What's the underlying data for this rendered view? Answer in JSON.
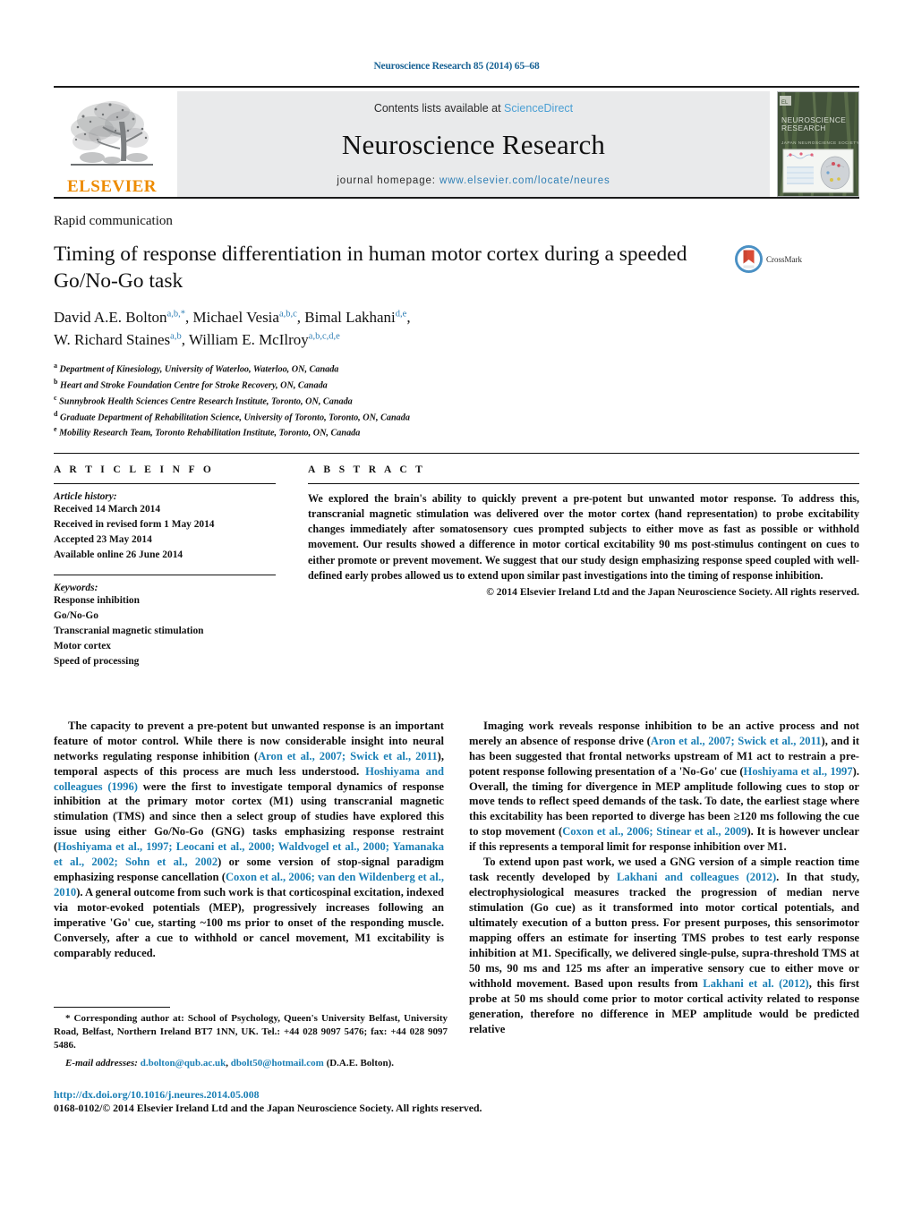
{
  "running_head": "Neuroscience Research 85 (2014) 65–68",
  "masthead": {
    "contents_prefix": "Contents lists available at",
    "sciencedirect": "ScienceDirect",
    "journal_title": "Neuroscience Research",
    "homepage_prefix": "journal homepage:",
    "homepage_url": "www.elsevier.com/locate/neures",
    "publisher_wordmark": "ELSEVIER",
    "publisher_color": "#ED8B00",
    "link_color": "#4a9fd4",
    "cover_title_line1": "NEUROSCIENCE",
    "cover_title_line2": "RESEARCH",
    "cover_subtitle": "JAPAN NEUROSCIENCE SOCIETY"
  },
  "article": {
    "type": "Rapid communication",
    "title": "Timing of response differentiation in human motor cortex during a speeded Go/No-Go task",
    "crossmark_label": "CrossMark",
    "authors_line1": "David A.E. Bolton",
    "authors_line1_sup": "a,b,*",
    "author2": "Michael Vesia",
    "author2_sup": "a,b,c",
    "author3": "Bimal Lakhani",
    "author3_sup": "d,e",
    "author4": "W. Richard Staines",
    "author4_sup": "a,b",
    "author5": "William E. McIlroy",
    "author5_sup": "a,b,c,d,e",
    "affiliations": [
      {
        "marker": "a",
        "text": "Department of Kinesiology, University of Waterloo, Waterloo, ON, Canada"
      },
      {
        "marker": "b",
        "text": "Heart and Stroke Foundation Centre for Stroke Recovery, ON, Canada"
      },
      {
        "marker": "c",
        "text": "Sunnybrook Health Sciences Centre Research Institute, Toronto, ON, Canada"
      },
      {
        "marker": "d",
        "text": "Graduate Department of Rehabilitation Science, University of Toronto, Toronto, ON, Canada"
      },
      {
        "marker": "e",
        "text": "Mobility Research Team, Toronto Rehabilitation Institute, Toronto, ON, Canada"
      }
    ]
  },
  "article_info": {
    "heading": "A R T I C L E   I N F O",
    "history_label": "Article history:",
    "history": [
      "Received 14 March 2014",
      "Received in revised form 1 May 2014",
      "Accepted 23 May 2014",
      "Available online 26 June 2014"
    ],
    "keywords_label": "Keywords:",
    "keywords": [
      "Response inhibition",
      "Go/No-Go",
      "Transcranial magnetic stimulation",
      "Motor cortex",
      "Speed of processing"
    ]
  },
  "abstract": {
    "heading": "A B S T R A C T",
    "text": "We explored the brain's ability to quickly prevent a pre-potent but unwanted motor response. To address this, transcranial magnetic stimulation was delivered over the motor cortex (hand representation) to probe excitability changes immediately after somatosensory cues prompted subjects to either move as fast as possible or withhold movement. Our results showed a difference in motor cortical excitability 90 ms post-stimulus contingent on cues to either promote or prevent movement. We suggest that our study design emphasizing response speed coupled with well-defined early probes allowed us to extend upon similar past investigations into the timing of response inhibition.",
    "copyright": "© 2014 Elsevier Ireland Ltd and the Japan Neuroscience Society. All rights reserved."
  },
  "body": {
    "left_p1_a": "The capacity to prevent a pre-potent but unwanted response is an important feature of motor control. While there is now considerable insight into neural networks regulating response inhibition (",
    "left_p1_cite1": "Aron et al., 2007; Swick et al., 2011",
    "left_p1_b": "), temporal aspects of this process are much less understood. ",
    "left_p1_cite2": "Hoshiyama and colleagues (1996)",
    "left_p1_c": " were the first to investigate temporal dynamics of response inhibition at the primary motor cortex (M1) using transcranial magnetic stimulation (TMS) and since then a select group of studies have explored this issue using either Go/No-Go (GNG) tasks emphasizing response restraint (",
    "left_p1_cite3": "Hoshiyama et al., 1997; Leocani et al., 2000; Waldvogel et al., 2000; Yamanaka et al., 2002; Sohn et al., 2002",
    "left_p1_d": ") or some version of stop-signal paradigm emphasizing response cancellation (",
    "left_p1_cite4": "Coxon et al., 2006; van den Wildenberg et al., 2010",
    "left_p1_e": "). A general outcome from such work is that corticospinal excitation, indexed via motor-evoked potentials (MEP), progressively increases following an imperative 'Go' cue, starting ~100 ms prior to onset of the responding muscle. Conversely, after a cue to withhold or cancel movement, M1 excitability is comparably reduced.",
    "right_p1_a": "Imaging work reveals response inhibition to be an active process and not merely an absence of response drive (",
    "right_p1_cite1": "Aron et al., 2007; Swick et al., 2011",
    "right_p1_b": "), and it has been suggested that frontal networks upstream of M1 act to restrain a pre-potent response following presentation of a 'No-Go' cue (",
    "right_p1_cite2": "Hoshiyama et al., 1997",
    "right_p1_c": "). Overall, the timing for divergence in MEP amplitude following cues to stop or move tends to reflect speed demands of the task. To date, the earliest stage where this excitability has been reported to diverge has been ≥120 ms following the cue to stop movement (",
    "right_p1_cite3": "Coxon et al., 2006; Stinear et al., 2009",
    "right_p1_d": "). It is however unclear if this represents a temporal limit for response inhibition over M1.",
    "right_p2_a": "To extend upon past work, we used a GNG version of a simple reaction time task recently developed by ",
    "right_p2_cite1": "Lakhani and colleagues (2012)",
    "right_p2_b": ". In that study, electrophysiological measures tracked the progression of median nerve stimulation (Go cue) as it transformed into motor cortical potentials, and ultimately execution of a button press. For present purposes, this sensorimotor mapping offers an estimate for inserting TMS probes to test early response inhibition at M1. Specifically, we delivered single-pulse, supra-threshold TMS at 50 ms, 90 ms and 125 ms after an imperative sensory cue to either move or withhold movement. Based upon results from ",
    "right_p2_cite2": "Lakhani et al. (2012)",
    "right_p2_c": ", this first probe at 50 ms should come prior to motor cortical activity related to response generation, therefore no difference in MEP amplitude would be predicted relative"
  },
  "footnote": {
    "text_a": "* Corresponding author at: School of Psychology, Queen's University Belfast, University Road, Belfast, Northern Ireland BT7 1NN, UK. Tel.: +44 028 9097 5476; fax: +44 028 9097 5486.",
    "email_label": "E-mail addresses:",
    "email1": "d.bolton@qub.ac.uk",
    "email_sep": ", ",
    "email2": "dbolt50@hotmail.com",
    "email_owner": " (D.A.E. Bolton)."
  },
  "bottom": {
    "doi": "http://dx.doi.org/10.1016/j.neures.2014.05.008",
    "issn": "0168-0102/© 2014 Elsevier Ireland Ltd and the Japan Neuroscience Society. All rights reserved."
  }
}
